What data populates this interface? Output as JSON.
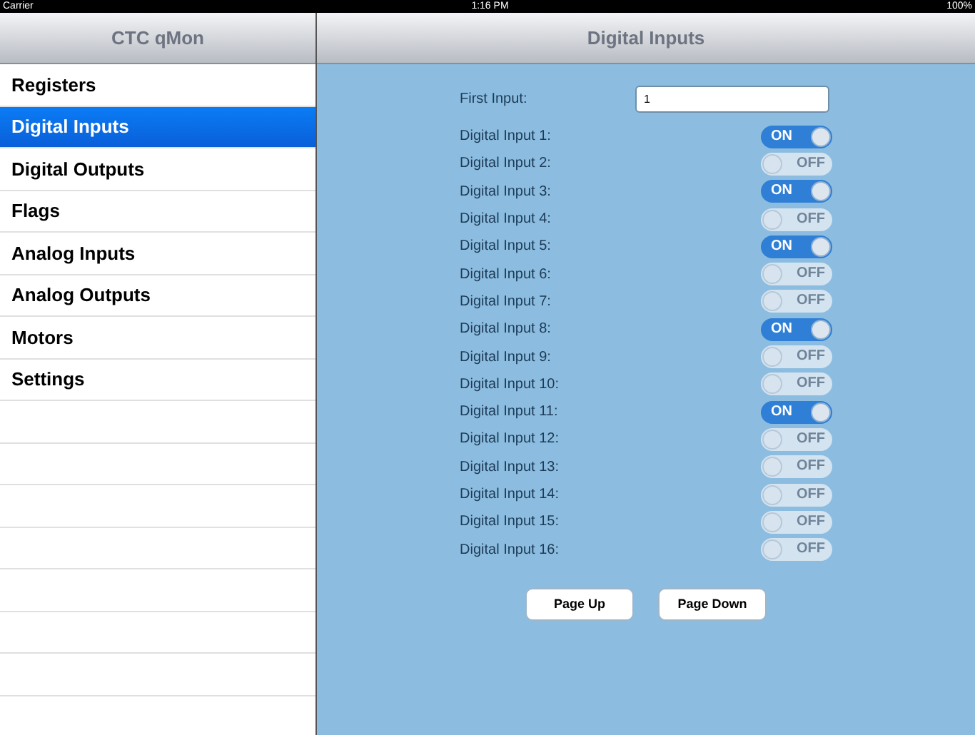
{
  "status_bar": {
    "carrier": "Carrier",
    "time": "1:16 PM",
    "battery": "100%"
  },
  "sidebar": {
    "title": "CTC qMon",
    "items": [
      {
        "label": "Registers",
        "selected": false
      },
      {
        "label": "Digital Inputs",
        "selected": true
      },
      {
        "label": "Digital Outputs",
        "selected": false
      },
      {
        "label": "Flags",
        "selected": false
      },
      {
        "label": "Analog Inputs",
        "selected": false
      },
      {
        "label": "Analog Outputs",
        "selected": false
      },
      {
        "label": "Motors",
        "selected": false
      },
      {
        "label": "Settings",
        "selected": false
      }
    ]
  },
  "detail": {
    "title": "Digital Inputs",
    "first_input": {
      "label": "First Input:",
      "value": "1"
    },
    "inputs": [
      {
        "label": "Digital Input 1:",
        "on": true,
        "switch_text": "ON"
      },
      {
        "label": "Digital Input 2:",
        "on": false,
        "switch_text": "OFF"
      },
      {
        "label": "Digital Input 3:",
        "on": true,
        "switch_text": "ON"
      },
      {
        "label": "Digital Input 4:",
        "on": false,
        "switch_text": "OFF"
      },
      {
        "label": "Digital Input 5:",
        "on": true,
        "switch_text": "ON"
      },
      {
        "label": "Digital Input 6:",
        "on": false,
        "switch_text": "OFF"
      },
      {
        "label": "Digital Input 7:",
        "on": false,
        "switch_text": "OFF"
      },
      {
        "label": "Digital Input 8:",
        "on": true,
        "switch_text": "ON"
      },
      {
        "label": "Digital Input 9:",
        "on": false,
        "switch_text": "OFF"
      },
      {
        "label": "Digital Input 10:",
        "on": false,
        "switch_text": "OFF"
      },
      {
        "label": "Digital Input 11:",
        "on": true,
        "switch_text": "ON"
      },
      {
        "label": "Digital Input 12:",
        "on": false,
        "switch_text": "OFF"
      },
      {
        "label": "Digital Input 13:",
        "on": false,
        "switch_text": "OFF"
      },
      {
        "label": "Digital Input 14:",
        "on": false,
        "switch_text": "OFF"
      },
      {
        "label": "Digital Input 15:",
        "on": false,
        "switch_text": "OFF"
      },
      {
        "label": "Digital Input 16:",
        "on": false,
        "switch_text": "OFF"
      }
    ],
    "buttons": [
      "Page Up",
      "Page Down"
    ]
  }
}
